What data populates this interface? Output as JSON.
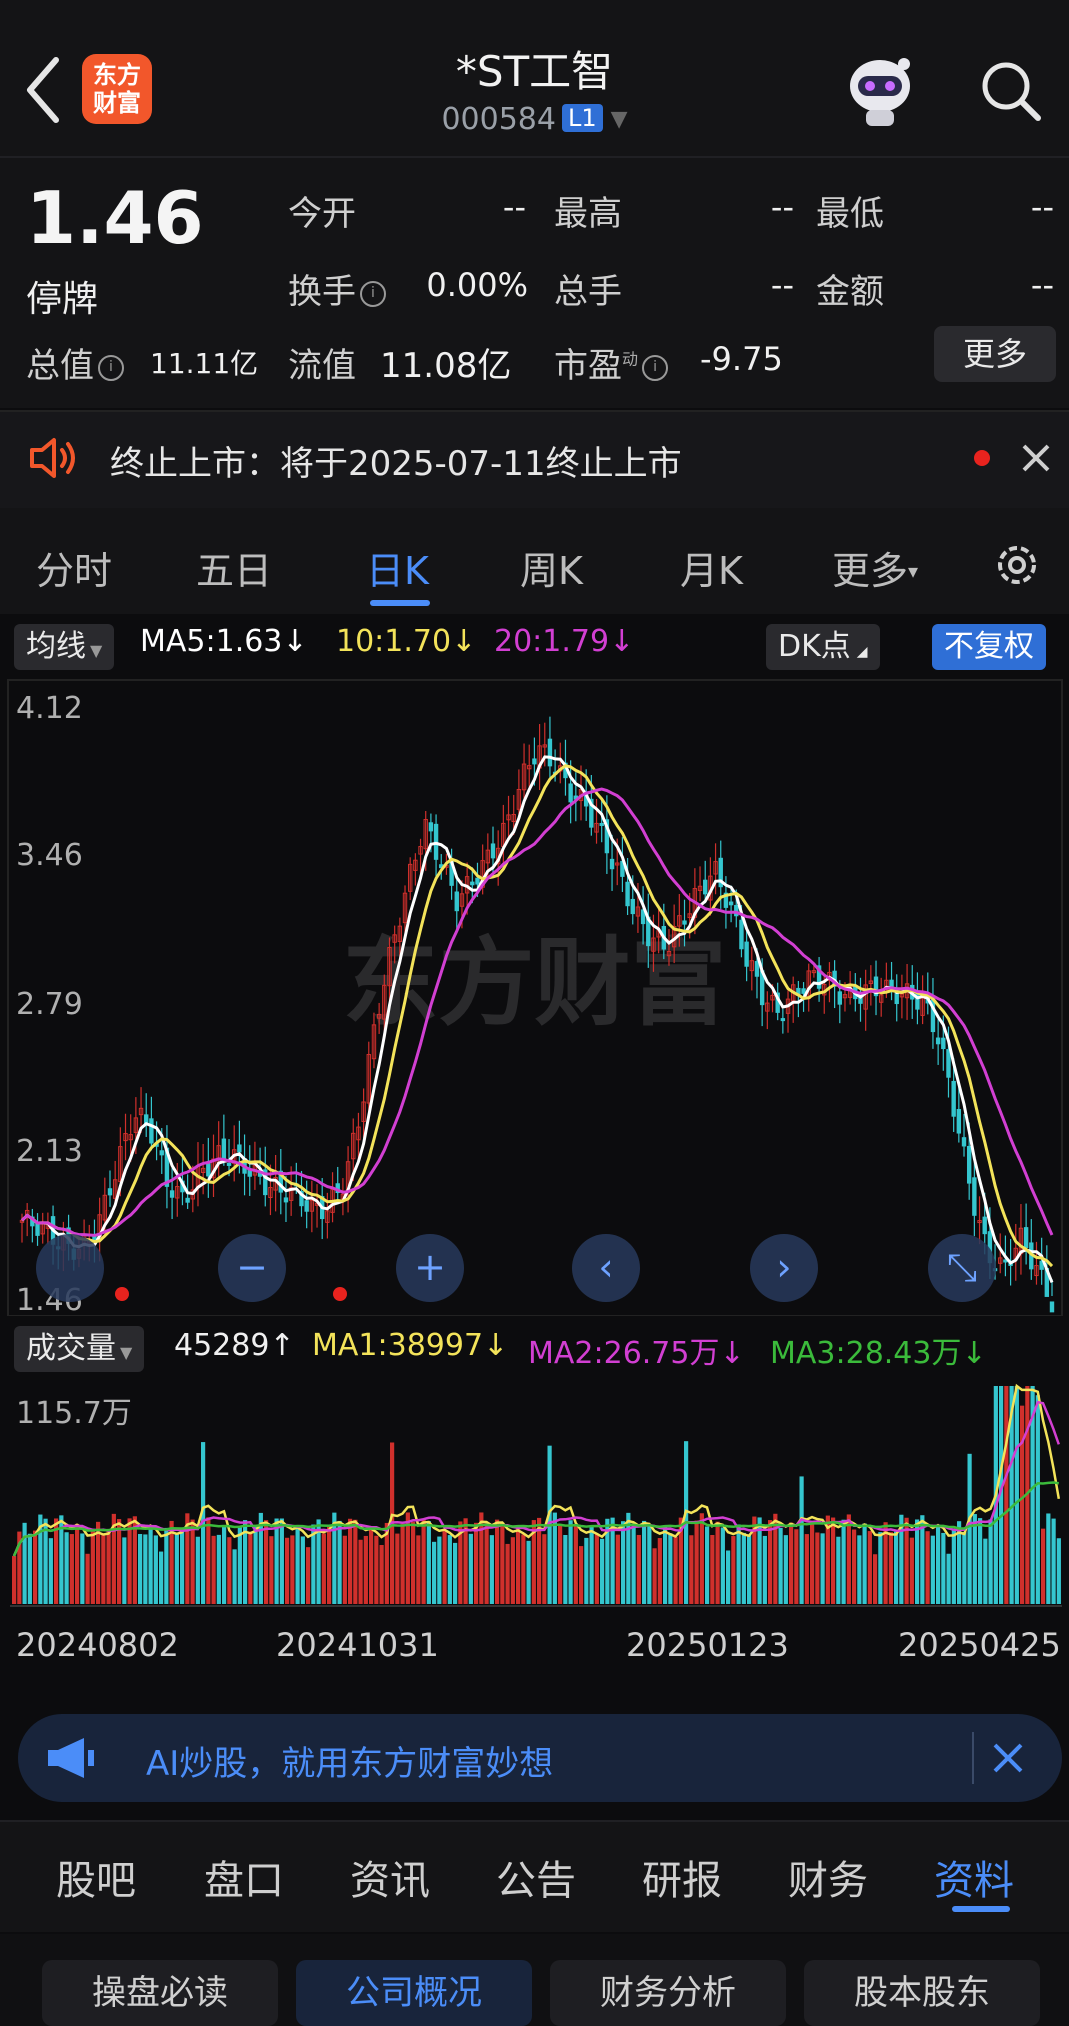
{
  "header": {
    "logo_line1": "东方",
    "logo_line2": "财富",
    "stock_name": "*ST工智",
    "stock_code": "000584",
    "level_badge": "L1",
    "icons": [
      "back-arrow-icon",
      "robot-avatar-icon",
      "search-icon"
    ]
  },
  "quote": {
    "price": "1.46",
    "status": "停牌",
    "fields": {
      "open_label": "今开",
      "open_value": "--",
      "high_label": "最高",
      "high_value": "--",
      "low_label": "最低",
      "low_value": "--",
      "turnover_label": "换手",
      "turnover_value": "0.00%",
      "volume_label": "总手",
      "volume_value": "--",
      "amount_label": "金额",
      "amount_value": "--",
      "mktcap_label": "总值",
      "mktcap_value": "11.11亿",
      "float_label": "流值",
      "float_value": "11.08亿",
      "pe_label": "市盈",
      "pe_sup": "动",
      "pe_value": "-9.75"
    },
    "more_label": "更多",
    "info_icon": "info-circle-icon"
  },
  "notice": {
    "text": "终止上市：将于2025-07-11终止上市",
    "icons": [
      "speaker-icon",
      "red-dot-icon",
      "close-icon"
    ]
  },
  "period_tabs": [
    {
      "label": "分时",
      "active": false
    },
    {
      "label": "五日",
      "active": false
    },
    {
      "label": "日K",
      "active": true
    },
    {
      "label": "周K",
      "active": false
    },
    {
      "label": "月K",
      "active": false
    },
    {
      "label": "更多",
      "active": false
    }
  ],
  "indicator": {
    "ma_select": "均线",
    "ma5": "MA5:1.63",
    "ma10": "10:1.70",
    "ma20": "20:1.79",
    "arrow": "↓",
    "dk_label": "DK点",
    "adjust_label": "不复权",
    "colors": {
      "ma5": "#ffffff",
      "ma10": "#f3e35a",
      "ma20": "#d23fd2"
    }
  },
  "chart_data": {
    "type": "candlestick",
    "y_ticks": [
      "4.12",
      "3.46",
      "2.79",
      "2.13",
      "1.46"
    ],
    "ylim": [
      1.46,
      4.12
    ],
    "x_ticks": [
      "20240802",
      "20241031",
      "20250123",
      "20250425"
    ],
    "series": [
      {
        "name": "MA5",
        "color": "#ffffff"
      },
      {
        "name": "MA10",
        "color": "#f3e35a"
      },
      {
        "name": "MA20",
        "color": "#d23fd2"
      }
    ],
    "close_samples": [
      1.8,
      1.75,
      1.7,
      1.68,
      1.72,
      1.85,
      2.05,
      2.25,
      2.2,
      2.0,
      1.92,
      2.0,
      2.05,
      2.08,
      2.05,
      2.0,
      1.95,
      1.9,
      1.82,
      1.85,
      2.0,
      2.3,
      2.7,
      3.0,
      3.3,
      3.6,
      3.45,
      3.25,
      3.3,
      3.4,
      3.55,
      3.8,
      3.95,
      3.85,
      3.7,
      3.65,
      3.55,
      3.4,
      3.2,
      3.05,
      3.0,
      3.15,
      3.3,
      3.4,
      3.2,
      2.95,
      2.8,
      2.75,
      2.85,
      2.9,
      2.85,
      2.78,
      2.82,
      2.88,
      2.85,
      2.8,
      2.75,
      2.6,
      2.3,
      1.95,
      1.65,
      1.55,
      1.7,
      1.6,
      1.46
    ],
    "volume": {
      "label": "成交量",
      "current": "45289",
      "ma1": "MA1:38997",
      "ma2": "MA2:26.75万",
      "ma3": "MA3:28.43万",
      "max_label": "115.7万",
      "colors": {
        "up": "#d0302c",
        "down": "#35c6cf",
        "ma1": "#f3e35a",
        "ma2": "#d23fd2",
        "ma3": "#3bbb3b"
      }
    }
  },
  "chart_controls": {
    "icons": [
      "zoom-out-icon",
      "zoom-in-icon",
      "prev-icon",
      "next-icon",
      "fullscreen-icon"
    ],
    "zoom_out": "−",
    "zoom_in": "+",
    "prev": "‹",
    "next": "›",
    "fullscreen": "⤡"
  },
  "ai_banner": {
    "text": "AI炒股，就用东方财富妙想",
    "icons": [
      "megaphone-icon",
      "close-icon"
    ]
  },
  "bottom_tabs": [
    {
      "label": "股吧",
      "active": false
    },
    {
      "label": "盘口",
      "active": false
    },
    {
      "label": "资讯",
      "active": false
    },
    {
      "label": "公告",
      "active": false
    },
    {
      "label": "研报",
      "active": false
    },
    {
      "label": "财务",
      "active": false
    },
    {
      "label": "资料",
      "active": true
    }
  ],
  "sub_tabs": [
    {
      "label": "操盘必读",
      "active": false
    },
    {
      "label": "公司概况",
      "active": true
    },
    {
      "label": "财务分析",
      "active": false
    },
    {
      "label": "股本股东",
      "active": false
    }
  ],
  "watermark": "东方财富"
}
